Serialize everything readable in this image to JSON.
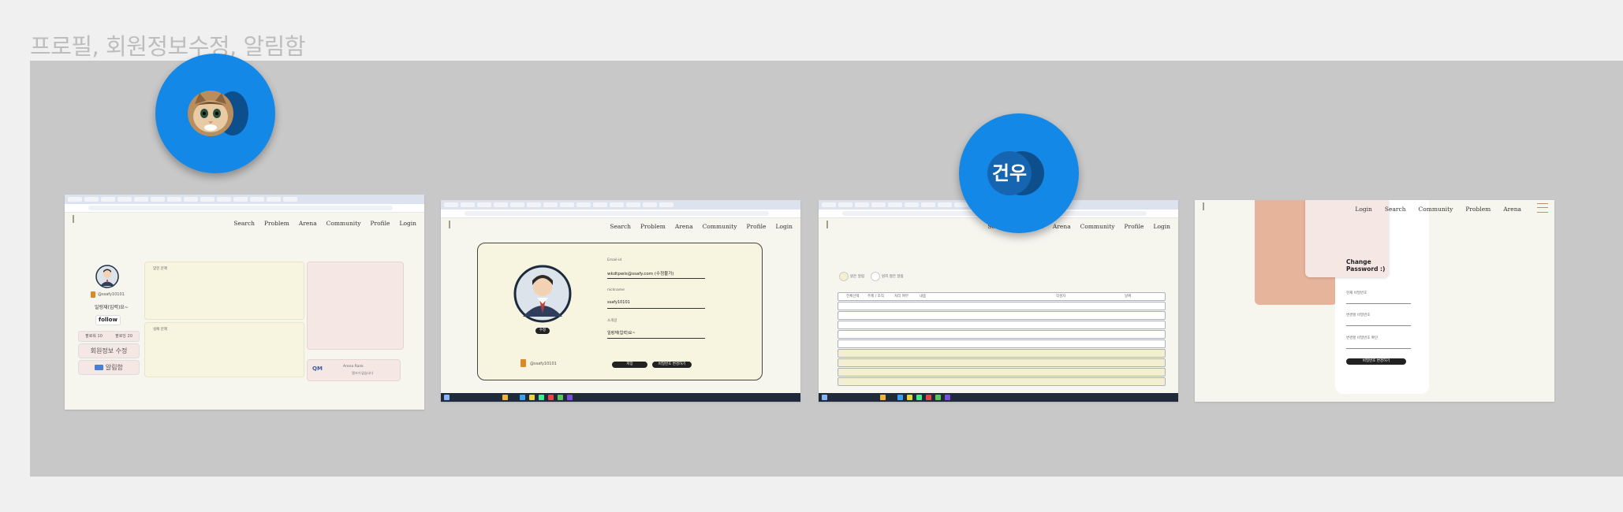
{
  "section_title": "프로필, 회원정보수정, 알림함",
  "nav": {
    "search": "Search",
    "problem": "Problem",
    "arena": "Arena",
    "community": "Community",
    "profile": "Profile",
    "login": "Login"
  },
  "profile_page": {
    "username": "@ssafy10101",
    "status_message": "일렁재(입력)요~",
    "follow_label": "follow",
    "follower_label": "팔로워",
    "follower_count": "10",
    "following_label": "팔로잉",
    "following_count": "20",
    "edit_profile_label": "회원정보 수정",
    "notifications_label": "알림함",
    "solved_label": "맞힌 문제",
    "failed_label": "실패 문제",
    "arena_label": "Arena Rank",
    "arena_sub": "랭크가 없습니다"
  },
  "edit_page": {
    "email_label": "Email-id",
    "email_value": "wkdtpwls@ssafy.com (수정불가)",
    "nickname_label": "nickname",
    "nickname_value": "ssafy10101",
    "bio_label": "소개글",
    "bio_value": "일렁재(입력)요~",
    "change_photo_label": "수정",
    "username": "@ssafy10101",
    "save_label": "저장",
    "change_password_label": "비밀번호 변경하기"
  },
  "notifications_page": {
    "filter_read": "읽은 알림",
    "filter_unread": "읽지 않은 알림",
    "columns": [
      "전체선택",
      "주제 / 조직",
      "처리 여부",
      "내용",
      "작성자",
      "날짜"
    ]
  },
  "password_page": {
    "title": "Change Password :)",
    "current_label": "현재 비밀번호",
    "new_label": "변경할 비밀번호",
    "confirm_label": "변경할 비밀번호 확인",
    "submit_label": "비밀번호 변경하기"
  },
  "avatars": {
    "cat_icon": "cat-photo-icon",
    "geonwoo_label": "건우"
  },
  "colors": {
    "canvas": "#c8c8c8",
    "page_bg": "#f6f5ee",
    "accent_blue": "#1488e6",
    "cream": "#f7f5e0",
    "pink": "#f5e8e4",
    "peach": "#e6b39b"
  }
}
